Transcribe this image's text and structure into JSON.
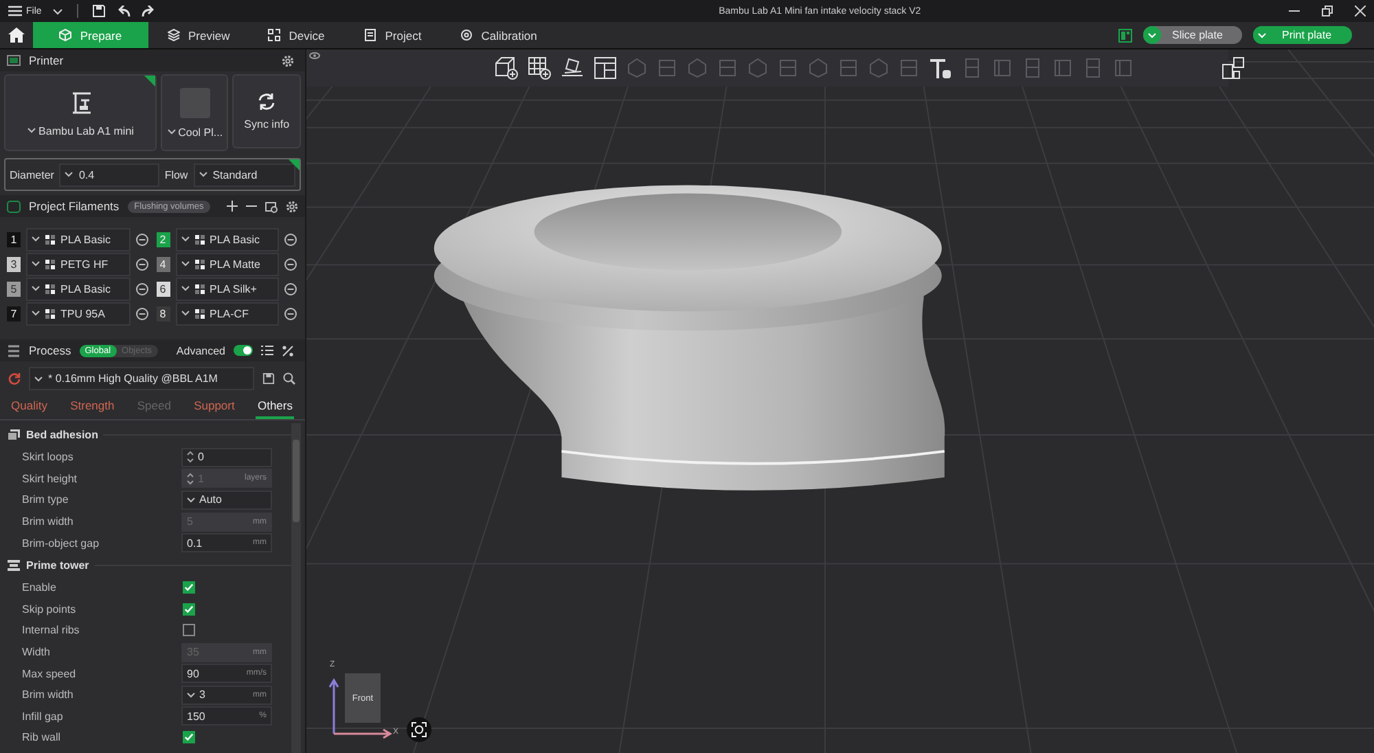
{
  "title_bar": {
    "menu": "File",
    "title": "Bambu Lab A1 Mini fan intake velocity stack V2"
  },
  "tabs": [
    {
      "label": "Prepare",
      "selected": true
    },
    {
      "label": "Preview",
      "selected": false
    },
    {
      "label": "Device",
      "selected": false
    },
    {
      "label": "Project",
      "selected": false
    },
    {
      "label": "Calibration",
      "selected": false
    }
  ],
  "actions": [
    {
      "label": "Slice plate",
      "primary": false
    },
    {
      "label": "Print plate",
      "primary": true
    }
  ],
  "printer": {
    "title": "Printer",
    "name": "Bambu Lab A1 mini",
    "plate": "Cool Pl...",
    "sync": "Sync info",
    "diameter_label": "Diameter",
    "diameter": "0.4",
    "flow_label": "Flow",
    "flow": "Standard"
  },
  "filaments": {
    "title": "Project Filaments",
    "flushing": "Flushing volumes",
    "items": [
      {
        "number": "1",
        "color": "#111111",
        "name": "PLA Basic"
      },
      {
        "number": "2",
        "color": "#1aa34a",
        "name": "PLA Basic"
      },
      {
        "number": "3",
        "color": "#c8c8c8",
        "name": "PETG HF"
      },
      {
        "number": "4",
        "color": "#6e6e6e",
        "name": "PLA Matte"
      },
      {
        "number": "5",
        "color": "#9a9a9a",
        "name": "PLA Basic"
      },
      {
        "number": "6",
        "color": "#d8d8d8",
        "name": "PLA Silk+"
      },
      {
        "number": "7",
        "color": "#141414",
        "name": "TPU 95A"
      },
      {
        "number": "8",
        "color": "#3a3a3a",
        "name": "PLA-CF"
      }
    ]
  },
  "process": {
    "title": "Process",
    "scope": [
      {
        "label": "Global",
        "selected": true
      },
      {
        "label": "Objects",
        "selected": false
      }
    ],
    "advanced_label": "Advanced",
    "advanced": true,
    "preset": "* 0.16mm High Quality @BBL A1M",
    "tabs": [
      {
        "label": "Quality",
        "selected": false,
        "modified": true
      },
      {
        "label": "Strength",
        "selected": false,
        "modified": true
      },
      {
        "label": "Speed",
        "selected": false,
        "modified": false
      },
      {
        "label": "Support",
        "selected": false,
        "modified": true
      },
      {
        "label": "Others",
        "selected": true,
        "modified": false
      }
    ],
    "groups": [
      {
        "title": "Bed adhesion",
        "kind": "adhesion",
        "rows": [
          {
            "label": "Skirt loops",
            "kind": "spin",
            "value": "0",
            "disabled": false
          },
          {
            "label": "Skirt height",
            "kind": "spin",
            "value": "1",
            "unit": "layers",
            "disabled": true
          },
          {
            "label": "Brim type",
            "kind": "combo",
            "value": "Auto",
            "disabled": false
          },
          {
            "label": "Brim width",
            "kind": "field",
            "value": "5",
            "unit": "mm",
            "disabled": true
          },
          {
            "label": "Brim-object gap",
            "kind": "field",
            "value": "0.1",
            "unit": "mm",
            "disabled": false
          }
        ]
      },
      {
        "title": "Prime tower",
        "kind": "tower",
        "rows": [
          {
            "label": "Enable",
            "kind": "check",
            "checked": true
          },
          {
            "label": "Skip points",
            "kind": "check",
            "checked": true
          },
          {
            "label": "Internal ribs",
            "kind": "check",
            "checked": false
          },
          {
            "label": "Width",
            "kind": "field",
            "value": "35",
            "unit": "mm",
            "disabled": true
          },
          {
            "label": "Max speed",
            "kind": "field",
            "value": "90",
            "unit": "mm/s",
            "disabled": false
          },
          {
            "label": "Brim width",
            "kind": "combo",
            "value": "3",
            "unit": "mm",
            "disabled": false
          },
          {
            "label": "Infill gap",
            "kind": "field",
            "value": "150",
            "unit": "%",
            "disabled": false
          },
          {
            "label": "Rib wall",
            "kind": "check",
            "checked": true
          }
        ]
      }
    ]
  },
  "viewport": {
    "view_label": "Front",
    "axis_z": "Z",
    "axis_x": "X"
  }
}
